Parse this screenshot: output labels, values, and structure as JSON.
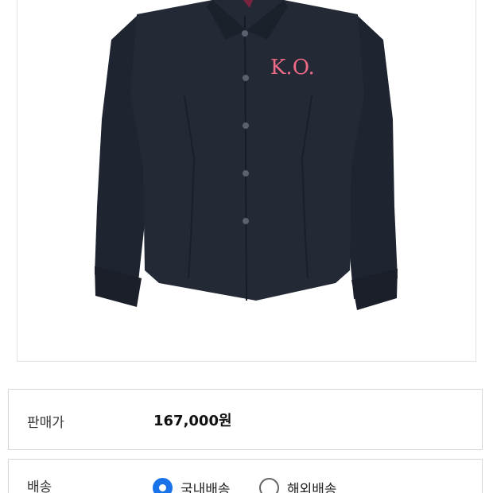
{
  "product": {
    "image_icon": "shirt-image",
    "shirt_logo": "K.O.",
    "colors": {
      "shirt": "#232a36",
      "logo": "#f06a86",
      "collar_accent": "#7a2340"
    }
  },
  "price": {
    "label": "판매가",
    "value": "167,000원"
  },
  "shipping": {
    "label": "배송",
    "options": [
      {
        "label": "국내배송",
        "selected": true
      },
      {
        "label": "해외배송",
        "selected": false
      }
    ],
    "accent": "#1a73e8"
  }
}
